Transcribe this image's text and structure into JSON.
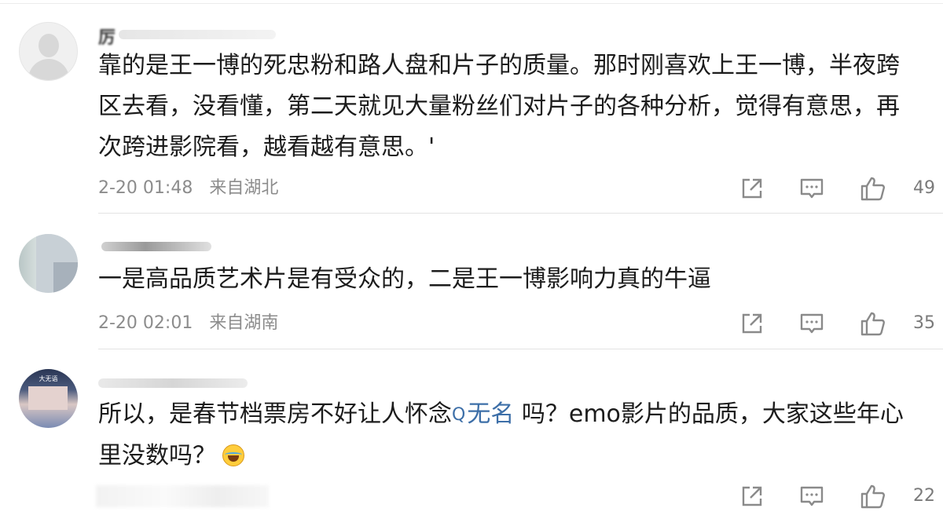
{
  "comments": [
    {
      "username_glyph": "厉",
      "text": "靠的是王一博的死忠粉和路人盘和片子的质量。那时刚喜欢上王一博，半夜跨区去看，没看懂，第二天就见大量粉丝们对片子的各种分析，觉得有意思，再次跨进影院看，越看越有意思。'",
      "time": "2-20 01:48",
      "location": "来自湖北",
      "likes": "49"
    },
    {
      "text": "一是高品质艺术片是有受众的，二是王一博影响力真的牛逼",
      "time": "2-20 02:01",
      "location": "来自湖南",
      "likes": "35"
    },
    {
      "avatar_tag": "大无语",
      "text_before": "所以，是春节档票房不好让人怀念",
      "topic_icon": "Q",
      "topic": "无名",
      "text_after": " 吗？emo影片的品质，大家这些年心里没数吗？",
      "emoji": "laughing-tears-emoji",
      "likes": "22"
    }
  ],
  "icons": {
    "share": "share-icon",
    "reply": "reply-comment-icon",
    "like": "thumbs-up-icon"
  },
  "colors": {
    "topic_link": "#3d6fa8",
    "meta_text": "#8c8c8c"
  }
}
